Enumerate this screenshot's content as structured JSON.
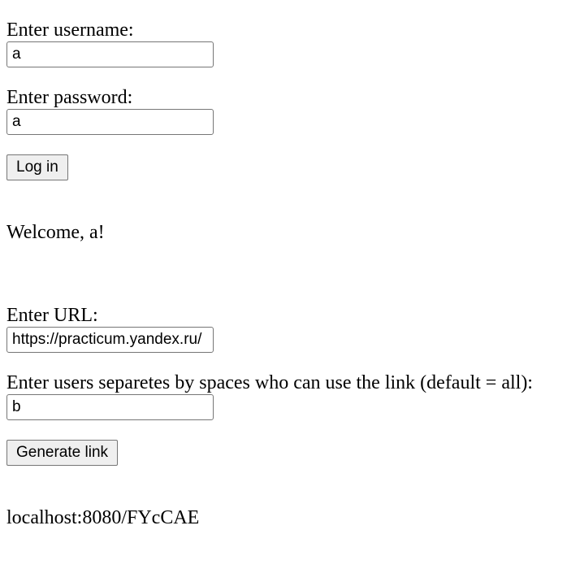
{
  "login": {
    "username_label": "Enter username:",
    "username_value": "a",
    "password_label": "Enter password:",
    "password_value": "a",
    "login_button": "Log in"
  },
  "welcome_message": "Welcome, a!",
  "link_form": {
    "url_label": "Enter URL:",
    "url_value": "https://practicum.yandex.ru/",
    "users_label": "Enter users separetes by spaces who can use the link (default = all):",
    "users_value": "b",
    "generate_button": "Generate link"
  },
  "generated_link": "localhost:8080/FYcCAE"
}
